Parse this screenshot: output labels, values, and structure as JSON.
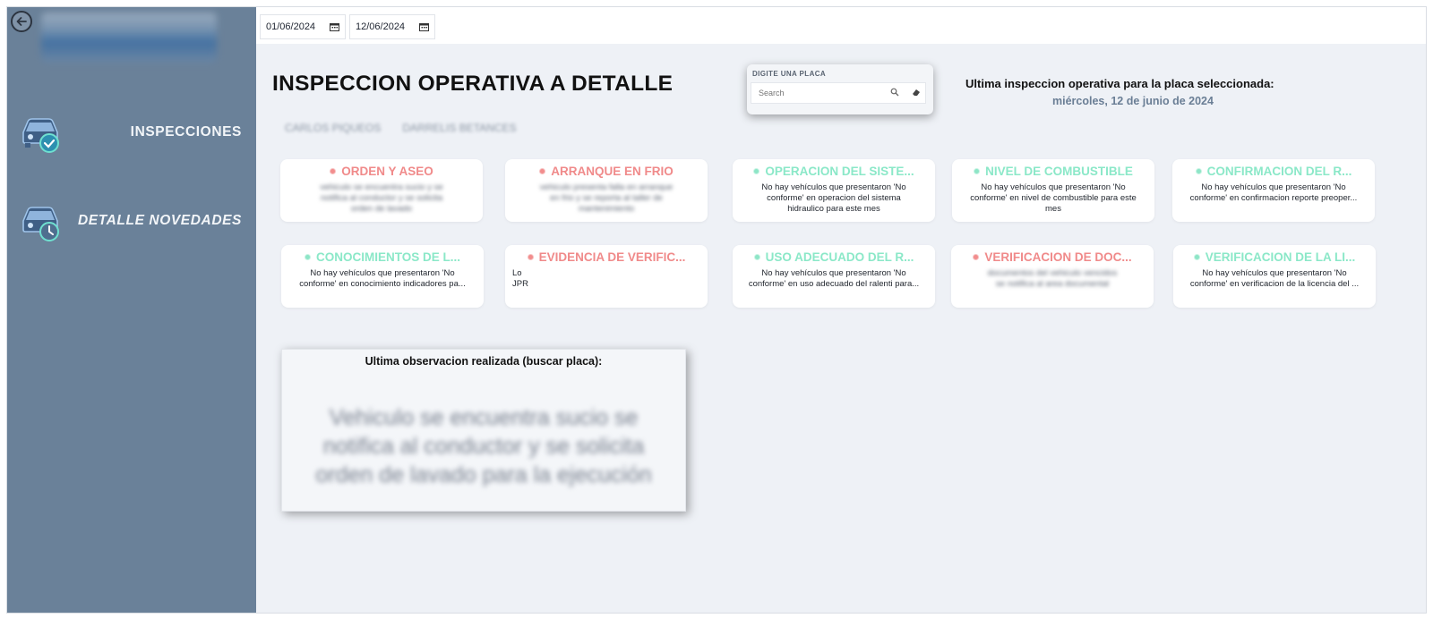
{
  "sidebar": {
    "nav": [
      {
        "label": "INSPECCIONES",
        "icon": "car-check-icon"
      },
      {
        "label": "DETALLE NOVEDADES",
        "icon": "car-clock-icon"
      }
    ]
  },
  "filters": {
    "date_start": "01/06/2024",
    "date_end": "12/06/2024"
  },
  "main": {
    "title": "INSPECCION OPERATIVA A DETALLE",
    "chips": [
      "CARLOS PIQUEOS",
      "DARRELIS BETANCES"
    ]
  },
  "search": {
    "label": "DIGITE UNA PLACA",
    "placeholder": "Search"
  },
  "last_inspection": {
    "title": "Ultima inspeccion operativa para la placa seleccionada:",
    "date": "miércoles, 12 de junio de 2024"
  },
  "cards": [
    {
      "title": "ORDEN Y ASEO",
      "status": "red",
      "lines": [
        "vehiculo se encuentra sucio y se",
        "notifica al conductor y se solicita",
        "orden de lavado"
      ]
    },
    {
      "title": "ARRANQUE EN FRIO",
      "status": "red",
      "lines": [
        "vehiculo presenta falla en arranque",
        "en frio y se reporta al taller de",
        "mantenimiento"
      ]
    },
    {
      "title": "OPERACION DEL SISTE...",
      "status": "green",
      "lines": [
        "No hay vehículos que presentaron 'No",
        "conforme' en operacion del sistema",
        "hidraulico para este mes"
      ]
    },
    {
      "title": "NIVEL DE COMBUSTIBLE",
      "status": "green",
      "lines": [
        "No hay vehículos que presentaron 'No",
        "conforme' en nivel de combustible para este",
        "mes"
      ]
    },
    {
      "title": "CONFIRMACION DEL R...",
      "status": "green",
      "lines": [
        "No hay vehículos que presentaron 'No",
        "conforme' en confirmacion reporte preoper..."
      ]
    },
    {
      "title": "CONOCIMIENTOS DE L...",
      "status": "green",
      "lines": [
        "No hay vehículos que presentaron 'No",
        "conforme' en conocimiento indicadores pa..."
      ]
    },
    {
      "title": "EVIDENCIA DE VERIFIC...",
      "status": "red",
      "lines": [
        "Lo",
        "JPR"
      ]
    },
    {
      "title": "USO ADECUADO DEL R...",
      "status": "green",
      "lines": [
        "No hay vehículos que presentaron 'No",
        "conforme' en uso adecuado del ralenti para..."
      ]
    },
    {
      "title": "VERIFICACION DE DOC...",
      "status": "red",
      "lines": [
        "documentos del vehiculo vencidos",
        "se notifica al area documental"
      ]
    },
    {
      "title": "VERIFICACION DE LA LI...",
      "status": "green",
      "lines": [
        "No hay vehículos que presentaron 'No",
        "conforme' en verificacion de la licencia del ..."
      ]
    }
  ],
  "observation": {
    "title": "Ultima observacion realizada (buscar placa):",
    "text": "Vehiculo se encuentra sucio se notifica al conductor y se solicita orden de lavado para la ejecución"
  }
}
